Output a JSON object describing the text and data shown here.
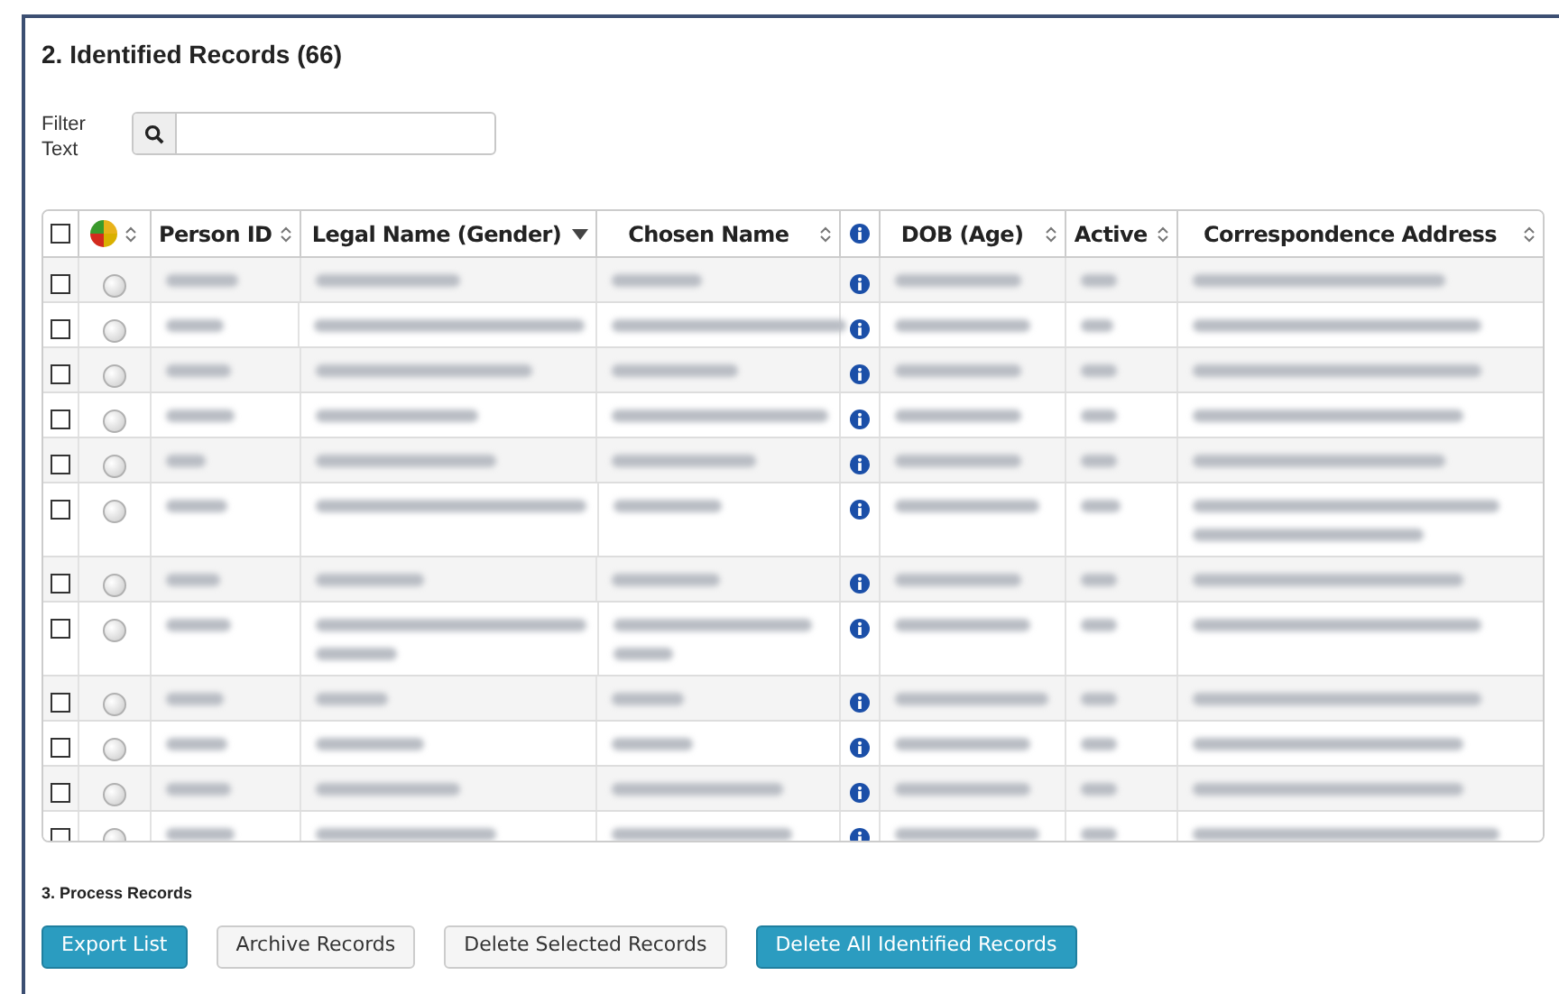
{
  "section_title": "2. Identified Records (66)",
  "filter": {
    "label": "Filter Text"
  },
  "table": {
    "header_checked": false,
    "columns": [
      {
        "kind": "check"
      },
      {
        "kind": "status",
        "sorted": false
      },
      {
        "kind": "text",
        "label": "Person ID",
        "sorted": false
      },
      {
        "kind": "text",
        "label": "Legal Name (Gender)",
        "sorted": true
      },
      {
        "kind": "text",
        "label": "Chosen Name",
        "sorted": false
      },
      {
        "kind": "info"
      },
      {
        "kind": "text",
        "label": "DOB (Age)",
        "sorted": false
      },
      {
        "kind": "text",
        "label": "Active",
        "sorted": false
      },
      {
        "kind": "text",
        "label": "Correspondence Address",
        "sorted": false
      }
    ],
    "rows": [
      {
        "checked": false,
        "kind": "single"
      },
      {
        "checked": false,
        "kind": "single"
      },
      {
        "checked": false,
        "kind": "single"
      },
      {
        "checked": false,
        "kind": "single"
      },
      {
        "checked": false,
        "kind": "single"
      },
      {
        "checked": false,
        "kind": "address_wrap"
      },
      {
        "checked": false,
        "kind": "single"
      },
      {
        "checked": false,
        "kind": "name_wrap"
      },
      {
        "checked": false,
        "kind": "single"
      },
      {
        "checked": false,
        "kind": "single"
      },
      {
        "checked": false,
        "kind": "single"
      },
      {
        "checked": false,
        "kind": "single"
      }
    ]
  },
  "process_title": "3. Process Records",
  "buttons": [
    {
      "label": "Export List",
      "kind": "primary"
    },
    {
      "label": "Archive Records",
      "kind": "default"
    },
    {
      "label": "Delete Selected Records",
      "kind": "default"
    },
    {
      "label": "Delete All Identified Records",
      "kind": "primary"
    }
  ]
}
